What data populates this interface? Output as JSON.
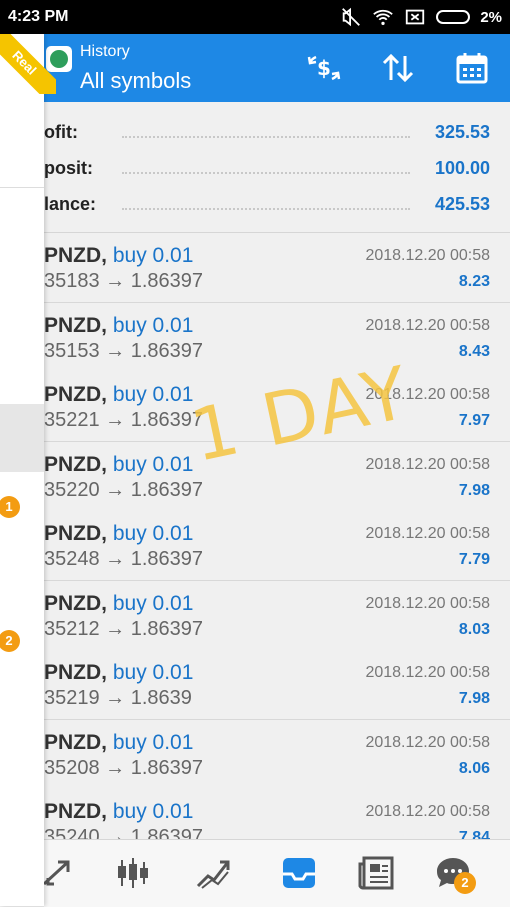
{
  "status_bar": {
    "time": "4:23 PM",
    "battery": "2%"
  },
  "drawer": {
    "account_ribbon": "Real",
    "badge_1": "1",
    "badge_2": "2"
  },
  "header": {
    "subtitle": "History",
    "title": "All symbols"
  },
  "summary": [
    {
      "label": "ofit:",
      "value": "325.53"
    },
    {
      "label": "posit:",
      "value": "100.00"
    },
    {
      "label": "lance:",
      "value": "425.53"
    }
  ],
  "trades": [
    {
      "symbol": "PNZD,",
      "action": "buy 0.01",
      "price": "35183 → 1.86397",
      "date": "2018.12.20 00:58",
      "profit": "8.23"
    },
    {
      "symbol": "PNZD,",
      "action": "buy 0.01",
      "price": "35153 → 1.86397",
      "date": "2018.12.20 00:58",
      "profit": "8.43"
    },
    {
      "symbol": "PNZD,",
      "action": "buy 0.01",
      "price": "35221 → 1.86397",
      "date": "2018.12.20 00:58",
      "profit": "7.97"
    },
    {
      "symbol": "PNZD,",
      "action": "buy 0.01",
      "price": "35220 → 1.86397",
      "date": "2018.12.20 00:58",
      "profit": "7.98"
    },
    {
      "symbol": "PNZD,",
      "action": "buy 0.01",
      "price": "35248 → 1.86397",
      "date": "2018.12.20 00:58",
      "profit": "7.79"
    },
    {
      "symbol": "PNZD,",
      "action": "buy 0.01",
      "price": "35212 → 1.86397",
      "date": "2018.12.20 00:58",
      "profit": "8.03"
    },
    {
      "symbol": "PNZD,",
      "action": "buy 0.01",
      "price": "35219 → 1.8639",
      "date": "2018.12.20 00:58",
      "profit": "7.98"
    },
    {
      "symbol": "PNZD,",
      "action": "buy 0.01",
      "price": "35208 → 1.86397",
      "date": "2018.12.20 00:58",
      "profit": "8.06"
    },
    {
      "symbol": "PNZD,",
      "action": "buy 0.01",
      "price": "35240 → 1.86397",
      "date": "2018.12.20 00:58",
      "profit": "7.84"
    }
  ],
  "overlay": "1 DAY",
  "bottom_nav": {
    "chat_badge": "2",
    "active": "history"
  },
  "colors": {
    "header": "#1e88e5",
    "accent": "#1a74c9",
    "badge": "#f39c12",
    "overlay": "#f5c542"
  }
}
